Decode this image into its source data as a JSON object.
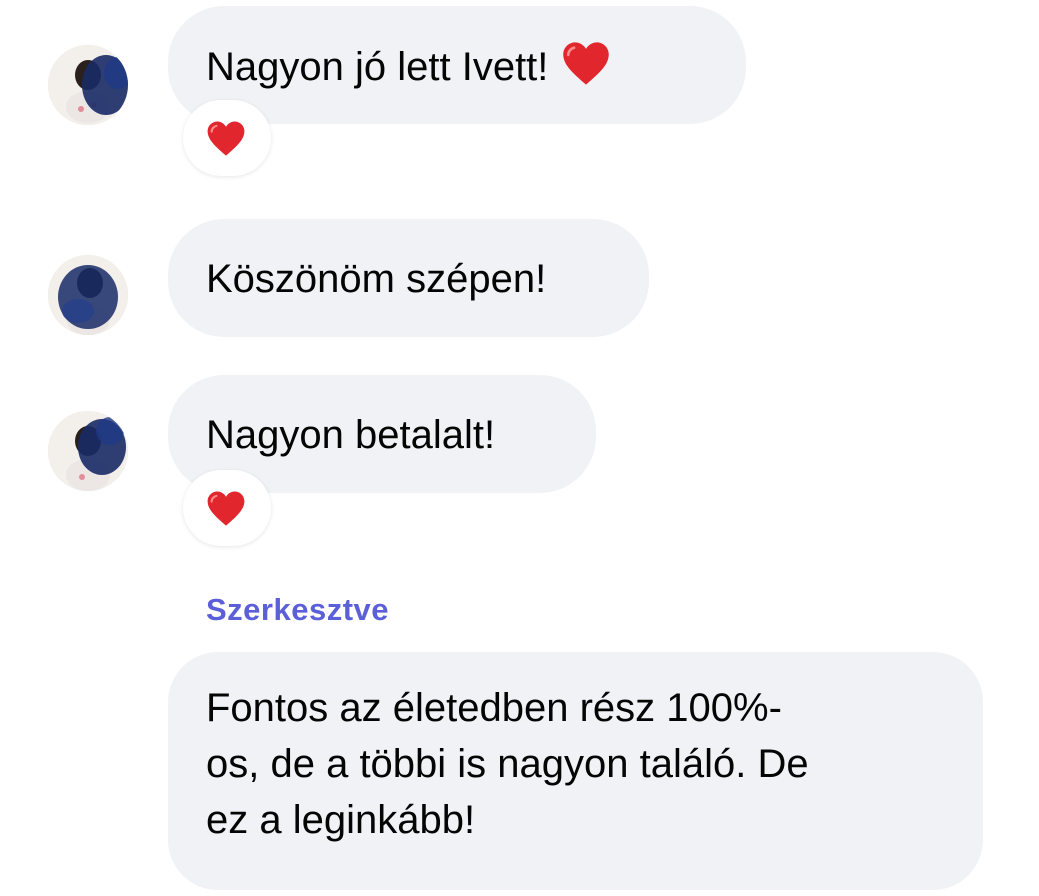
{
  "colors": {
    "bubble_bg": "#f0f2f5",
    "edited_label": "#5b5fd8",
    "heart": "#e2262d"
  },
  "messages": [
    {
      "text": "Nagyon jó lett Ivett!",
      "inline_emoji": "heart-icon",
      "reaction": "heart-icon"
    },
    {
      "text": "Köszönöm szépen!"
    },
    {
      "text": "Nagyon betalalt!",
      "reaction": "heart-icon"
    }
  ],
  "edited_label": "Szerkesztve",
  "reply": {
    "lines": [
      "Fontos az életedben rész 100%-",
      "os, de a többi is nagyon találó. De",
      "ez a leginkább!"
    ]
  }
}
